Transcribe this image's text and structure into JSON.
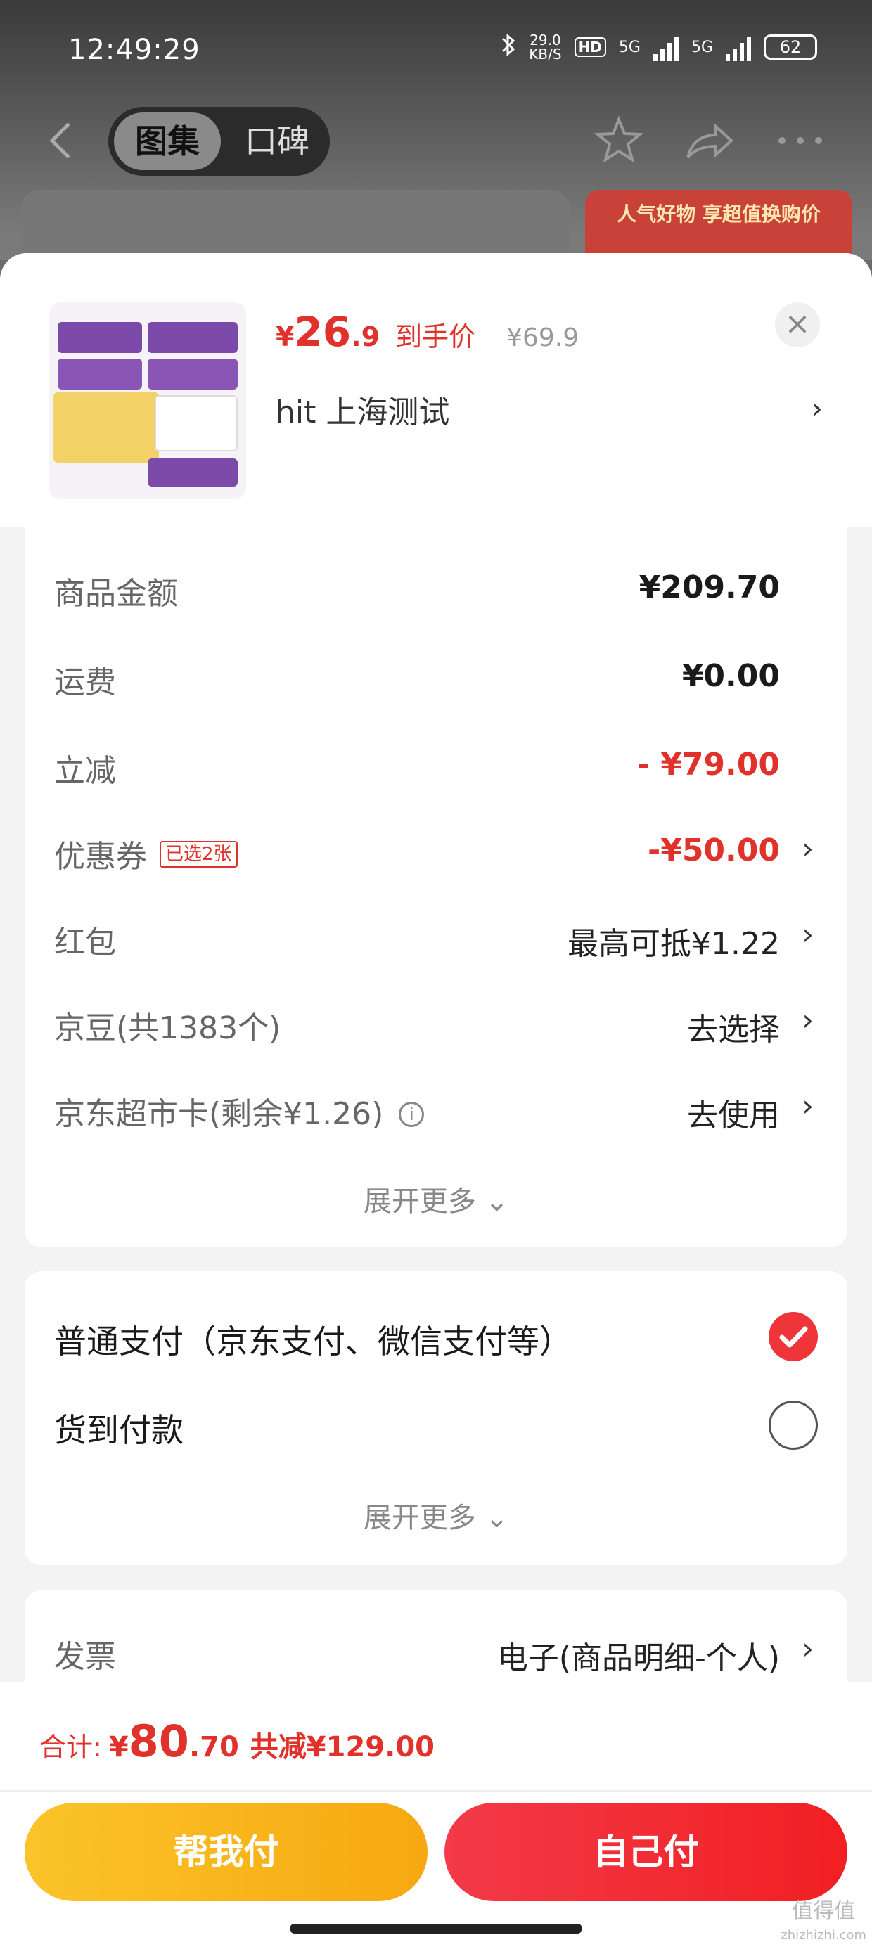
{
  "status_bar": {
    "time": "12:49:29",
    "net_speed_value": "29.0",
    "net_speed_unit": "KB/S",
    "hd_label": "HD",
    "sim1": "5G",
    "sim2": "5G",
    "battery": "62"
  },
  "top_nav": {
    "tab_gallery": "图集",
    "tab_reviews": "口碑",
    "promo_text": "人气好物 享超值换购价"
  },
  "product": {
    "currency": "¥",
    "price_int": "26",
    "price_dec": ".9",
    "price_tag": "到手价",
    "original_price": "¥69.9",
    "shop_name": "hit  上海测试",
    "close_symbol": "×"
  },
  "costs": {
    "goods_amount_label": "商品金额",
    "goods_amount_value": "¥209.70",
    "shipping_label": "运费",
    "shipping_value": "¥0.00",
    "instant_discount_label": "立减",
    "instant_discount_value": "- ¥79.00",
    "coupon_label": "优惠券",
    "coupon_badge": "已选2张",
    "coupon_value": "-¥50.00",
    "red_packet_label": "红包",
    "red_packet_value": "最高可抵¥1.22",
    "jingdou_label": "京豆(共1383个)",
    "jingdou_value": "去选择",
    "supermarket_card_label": "京东超市卡(剩余¥1.26)",
    "supermarket_card_value": "去使用",
    "expand_more": "展开更多"
  },
  "payment": {
    "normal_pay_label": "普通支付（京东支付、微信支付等）",
    "normal_pay_selected": true,
    "cod_label": "货到付款",
    "cod_selected": false,
    "expand_more": "展开更多"
  },
  "invoice": {
    "label": "发票",
    "value": "电子(商品明细-个人)"
  },
  "footer": {
    "total_label": "合计:",
    "currency": "¥",
    "total_int": "80",
    "total_dec": ".70",
    "total_discount": "共减¥129.00",
    "help_pay_button": "帮我付",
    "self_pay_button": "自己付"
  },
  "watermark": {
    "text": "值得值",
    "sub": "zhizhizhi.com"
  },
  "colors": {
    "accent_red": "#e0322a",
    "button_yellow": "#fbc42a",
    "button_red": "#f11f22"
  }
}
